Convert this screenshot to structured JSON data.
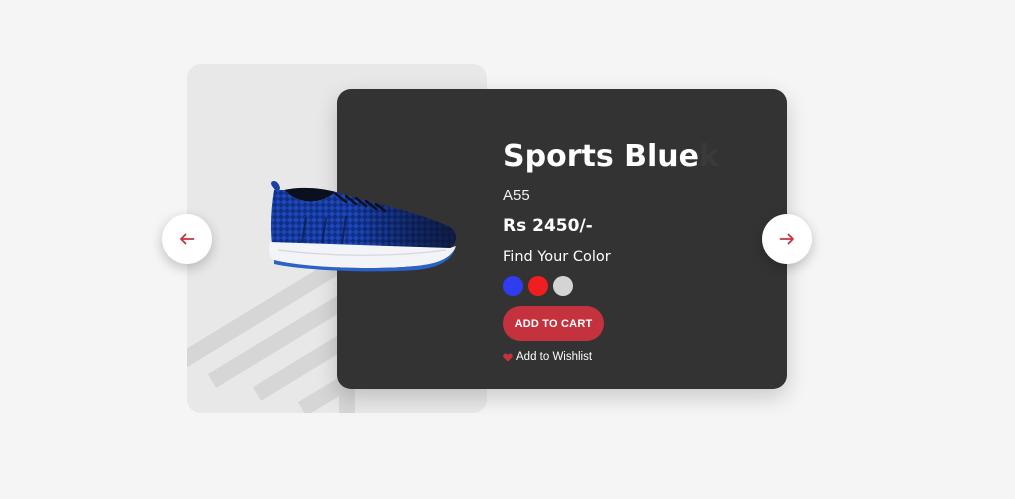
{
  "product": {
    "title": "Sports Blue",
    "title_overflow": "k",
    "model": "A55",
    "price": "Rs 2450/-",
    "color_label": "Find Your Color",
    "colors": [
      "#2f3cf0",
      "#f01e1e",
      "#d4d4d4"
    ],
    "add_to_cart": "ADD TO CART",
    "wishlist": "Add to Wishlist"
  },
  "theme": {
    "accent": "#c4323e",
    "card_dark": "#333333",
    "card_light": "#e8e8e8",
    "page_bg": "#f5f5f5"
  },
  "icons": {
    "prev": "arrow-left-icon",
    "next": "arrow-right-icon",
    "wishlist": "heart-icon"
  }
}
